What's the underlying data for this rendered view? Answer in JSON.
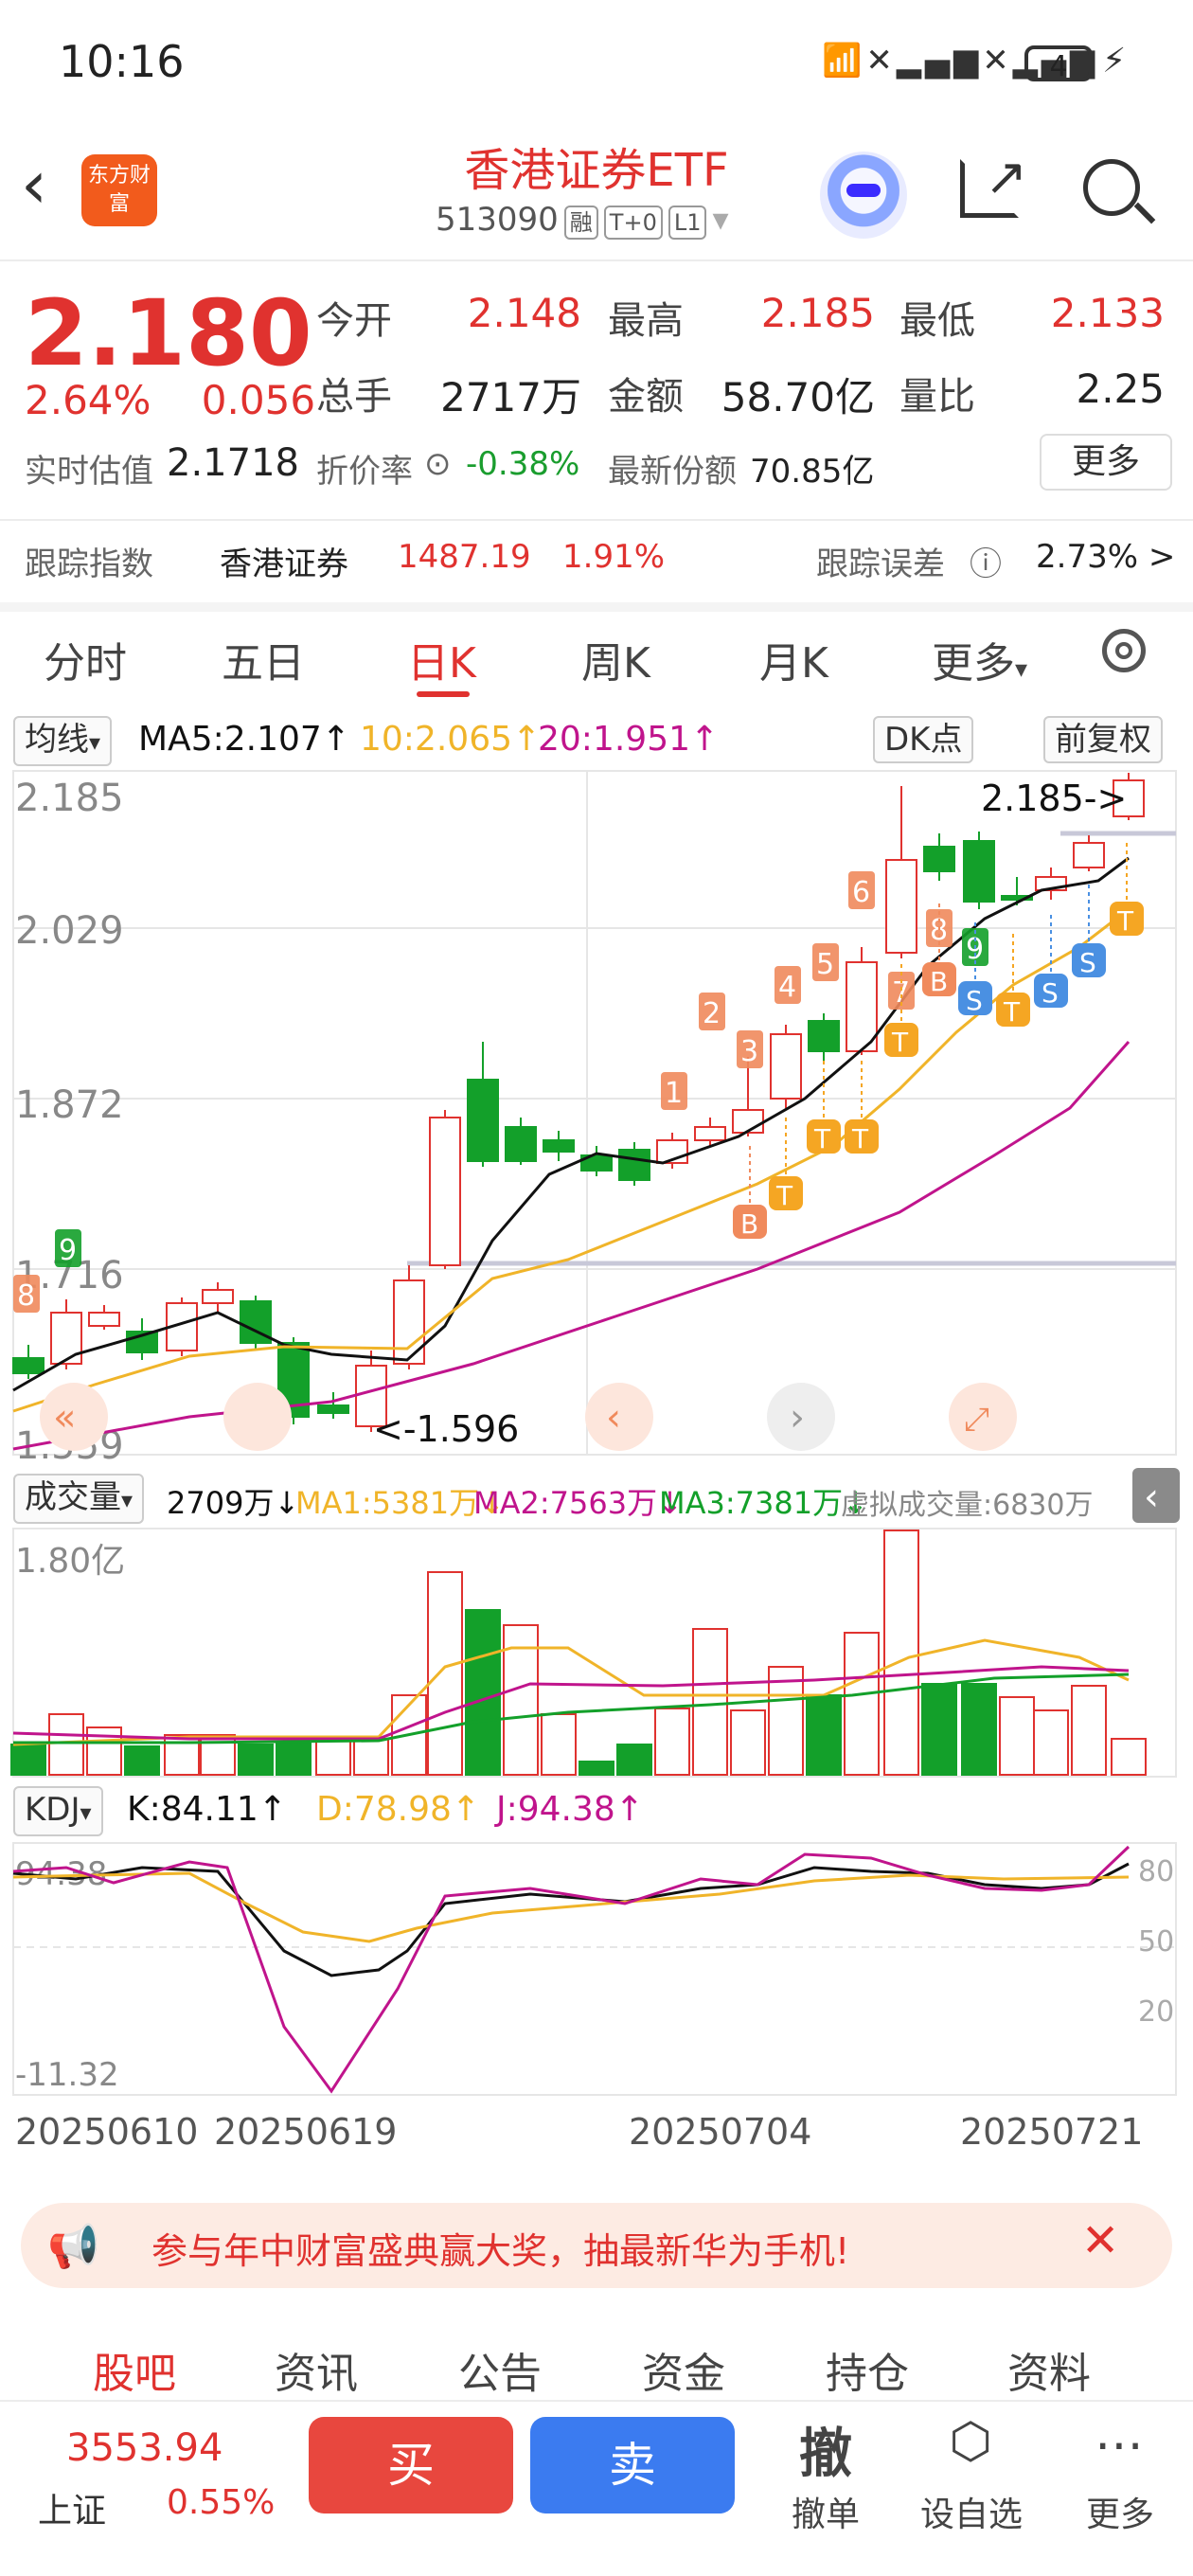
{
  "status": {
    "time": "10:16",
    "battery": "4"
  },
  "header": {
    "logo": "东方财富",
    "title": "香港证券ETF",
    "code": "513090",
    "tags": [
      "融",
      "T+0",
      "L1"
    ]
  },
  "quote": {
    "price": "2.180",
    "change_pct": "2.64%",
    "change": "0.056",
    "open_label": "今开",
    "open": "2.148",
    "high_label": "最高",
    "high": "2.185",
    "low_label": "最低",
    "low": "2.133",
    "volume_label": "总手",
    "volume": "2717万",
    "amount_label": "金额",
    "amount": "58.70亿",
    "ratio_label": "量比",
    "ratio": "2.25",
    "iopv_label": "实时估值",
    "iopv": "2.1718",
    "discount_label": "折价率",
    "discount": "-0.38%",
    "shares_label": "最新份额",
    "shares": "70.85亿",
    "more": "更多"
  },
  "tracking": {
    "label": "跟踪指数",
    "index_name": "香港证券",
    "index_value": "1487.19",
    "index_pct": "1.91%",
    "error_label": "跟踪误差",
    "error": "2.73% >"
  },
  "tabs": [
    "分时",
    "五日",
    "日K",
    "周K",
    "月K",
    "更多"
  ],
  "ma_bar": {
    "selector": "均线",
    "ma5": "MA5:2.107↑",
    "ma10": "10:2.065↑",
    "ma20": "20:1.951↑",
    "dk": "DK点",
    "fq": "前复权"
  },
  "kline": {
    "y_labels": [
      "2.185",
      "2.029",
      "1.872",
      "1.716",
      "1.559"
    ],
    "high_marker": "2.185->",
    "low_marker": "<-1.596",
    "signal_numbers": [
      "8",
      "9",
      "1",
      "2",
      "3",
      "4",
      "5",
      "6",
      "7",
      "8",
      "9"
    ],
    "signal_letters": [
      "B",
      "T",
      "T",
      "T",
      "T",
      "B",
      "S",
      "T",
      "S",
      "S",
      "T"
    ]
  },
  "volume_bar": {
    "selector": "成交量",
    "vol": "2709万↓",
    "ma1": "MA1:5381万↓",
    "ma2": "MA2:7563万↓",
    "ma3": "MA3:7381万↓",
    "virtual": "虚拟成交量:6830万",
    "max_label": "1.80亿"
  },
  "kdj_bar": {
    "selector": "KDJ",
    "k": "K:84.11↑",
    "d": "D:78.98↑",
    "j": "J:94.38↑",
    "top": "94.38",
    "bottom": "-11.32",
    "levels": [
      "80",
      "50",
      "20"
    ]
  },
  "dates": [
    "20250610",
    "20250619",
    "20250704",
    "20250721"
  ],
  "banner": {
    "text": "参与年中财富盛典赢大奖，抽最新华为手机!"
  },
  "bottom_tabs": [
    "股吧",
    "资讯",
    "公告",
    "资金",
    "持仓",
    "资料"
  ],
  "market": {
    "value": "3553.94",
    "name": "上证",
    "pct": "0.55%"
  },
  "actions": {
    "buy": "买",
    "sell": "卖",
    "cancel_icon": "撤",
    "cancel": "撤单",
    "watch": "设自选",
    "more": "更多"
  },
  "colors": {
    "up": "#e0322f",
    "down": "#13a02a",
    "ma5": "#111111",
    "ma10": "#f0b429",
    "ma20": "#c0148c"
  }
}
